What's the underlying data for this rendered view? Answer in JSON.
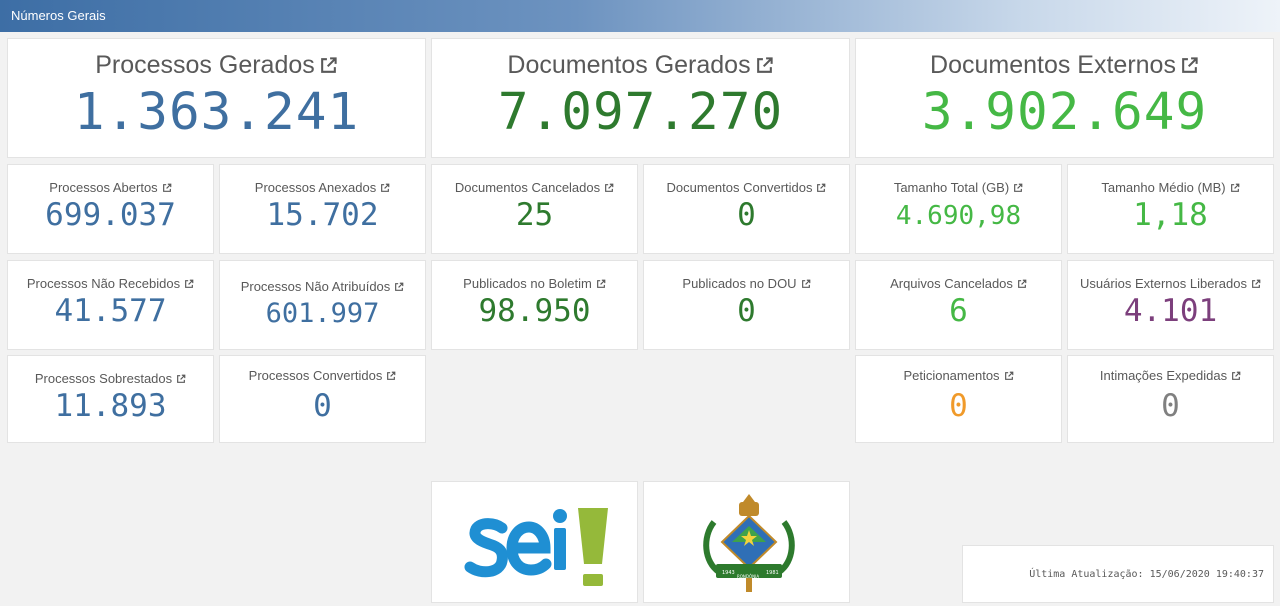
{
  "header": {
    "title": "Números Gerais"
  },
  "colors": {
    "blue": "#3f6fa0",
    "dark_green": "#2e7a2e",
    "light_green": "#45b845",
    "purple": "#7c3f7c",
    "orange": "#f09a2a",
    "gray": "#808080"
  },
  "big_cards": [
    {
      "label": "Processos Gerados",
      "value": "1.363.241",
      "color": "blue"
    },
    {
      "label": "Documentos Gerados",
      "value": "7.097.270",
      "color": "dark_green"
    },
    {
      "label": "Documentos Externos",
      "value": "3.902.649",
      "color": "light_green"
    }
  ],
  "small_cards": [
    {
      "label": "Processos Abertos",
      "value": "699.037",
      "color": "blue"
    },
    {
      "label": "Processos Anexados",
      "value": "15.702",
      "color": "blue"
    },
    {
      "label": "Documentos Cancelados",
      "value": "25",
      "color": "dark_green"
    },
    {
      "label": "Documentos Convertidos",
      "value": "0",
      "color": "dark_green"
    },
    {
      "label": "Tamanho Total (GB)",
      "value": "4.690,98",
      "color": "light_green"
    },
    {
      "label": "Tamanho Médio (MB)",
      "value": "1,18",
      "color": "light_green"
    },
    {
      "label": "Processos Não Recebidos",
      "value": "41.577",
      "color": "blue"
    },
    {
      "label": "Processos Não Atribuídos",
      "value": "601.997",
      "color": "blue"
    },
    {
      "label": "Publicados no Boletim",
      "value": "98.950",
      "color": "dark_green"
    },
    {
      "label": "Publicados no DOU",
      "value": "0",
      "color": "dark_green"
    },
    {
      "label": "Arquivos Cancelados",
      "value": "6",
      "color": "light_green"
    },
    {
      "label": "Usuários Externos Liberados",
      "value": "4.101",
      "color": "purple"
    },
    {
      "label": "Processos Sobrestados",
      "value": "11.893",
      "color": "blue"
    },
    {
      "label": "Processos Convertidos",
      "value": "0",
      "color": "blue"
    },
    {
      "label": "Peticionamentos",
      "value": "0",
      "color": "orange"
    },
    {
      "label": "Intimações Expedidas",
      "value": "0",
      "color": "gray"
    }
  ],
  "logos": {
    "sei": {
      "icon": "sei-logo",
      "text": "sei!"
    },
    "coat_of_arms": {
      "icon": "rondonia-coat-of-arms-icon",
      "years_left": "1943",
      "years_right": "1981",
      "banner": "RONDÔNIA"
    }
  },
  "footer": {
    "last_update": "Última Atualização: 15/06/2020 19:40:37"
  }
}
